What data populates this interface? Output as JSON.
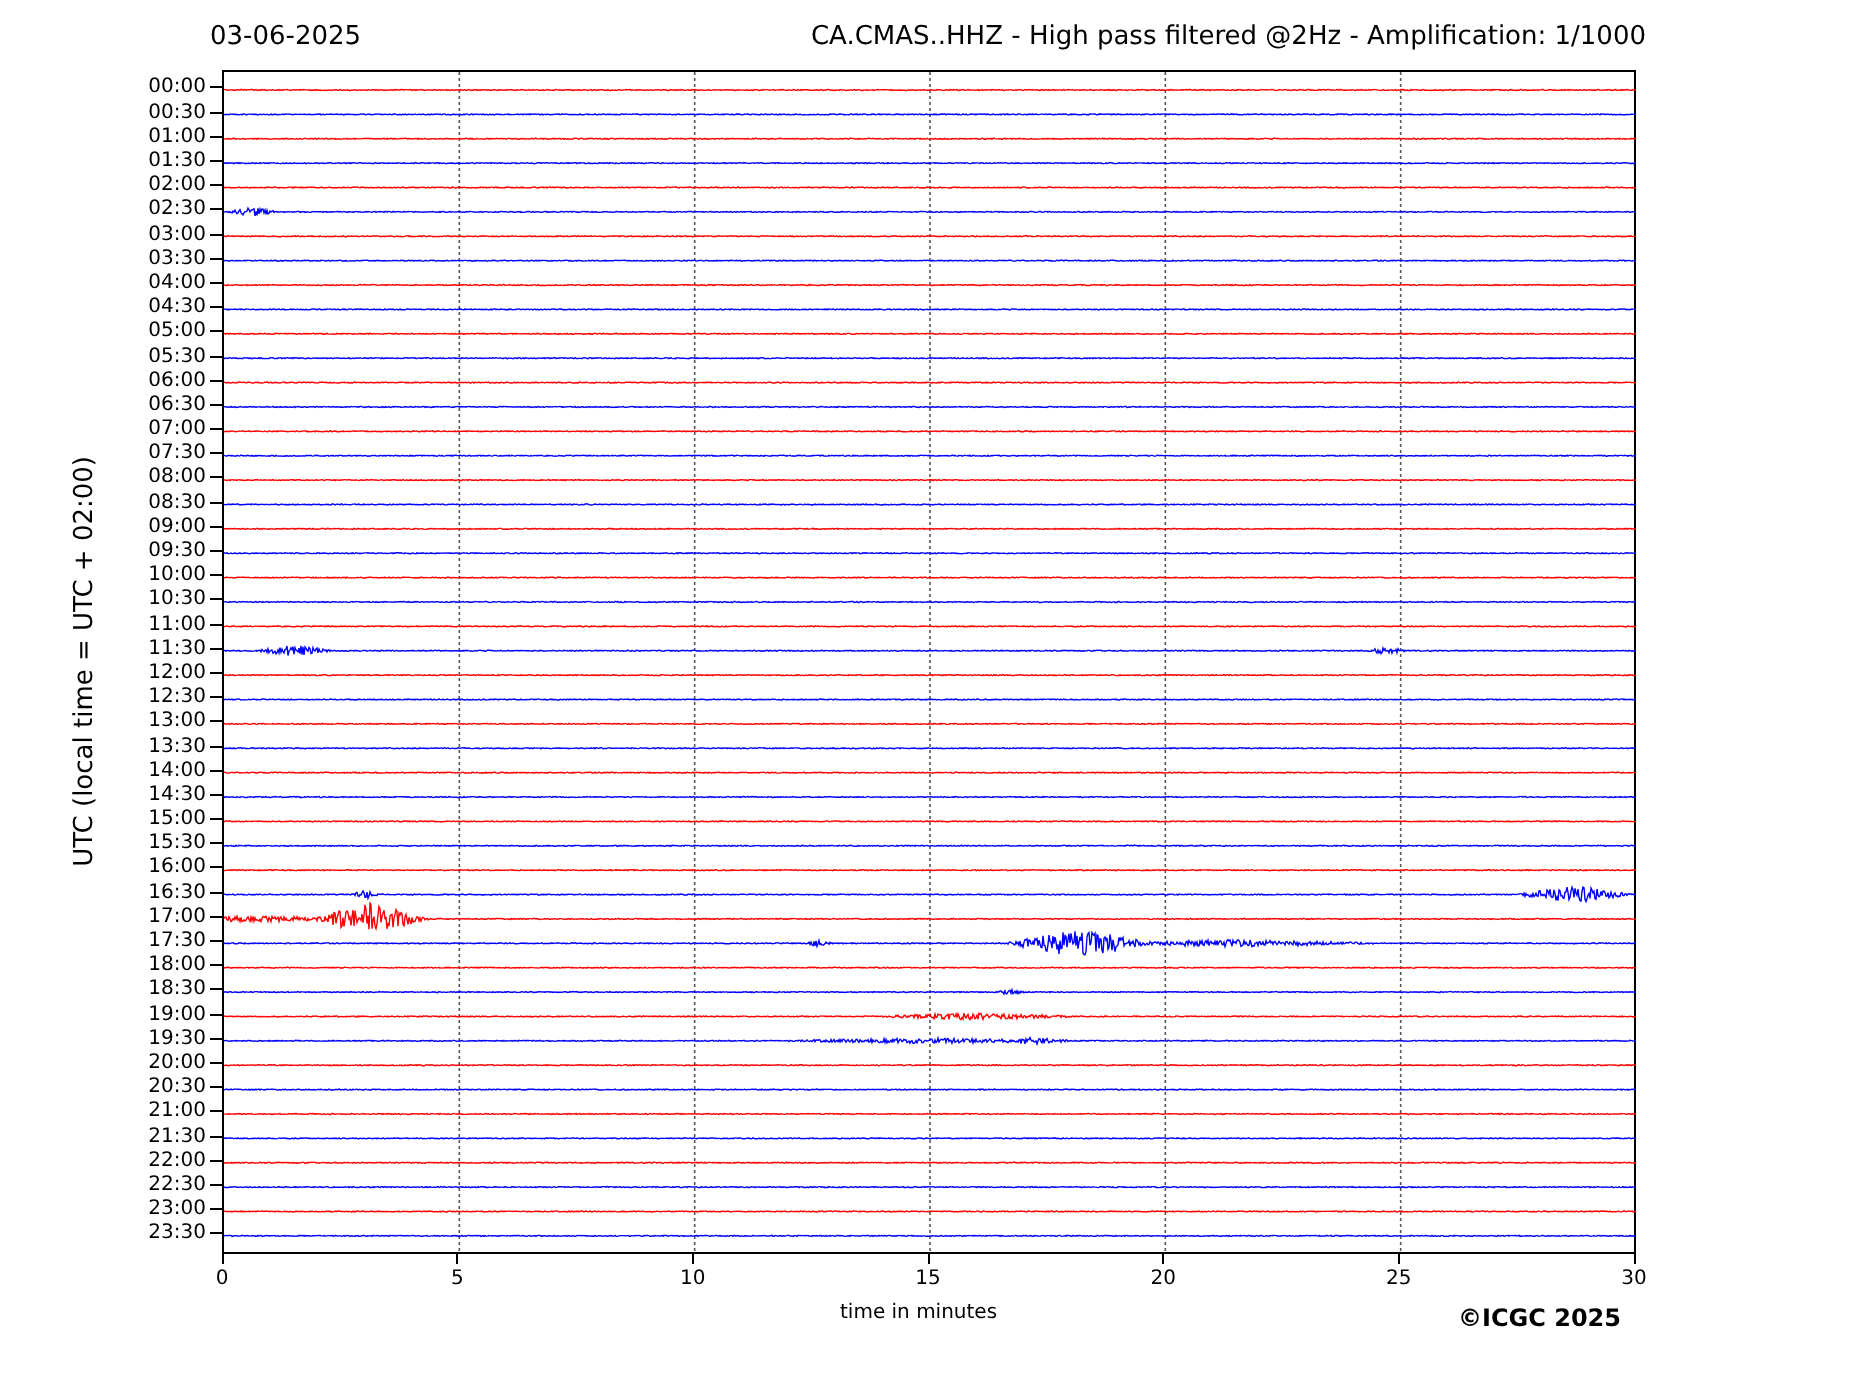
{
  "title_left": "03-06-2025",
  "title_right": "CA.CMAS..HHZ - High pass filtered @2Hz - Amplification: 1/1000",
  "y_axis_label": "UTC (local time = UTC + 02:00)",
  "rows": [
    {
      "label": "00:00",
      "color": "#ff0000"
    },
    {
      "label": "00:30",
      "color": "#0000ff"
    },
    {
      "label": "01:00",
      "color": "#ff0000"
    },
    {
      "label": "01:30",
      "color": "#0000ff"
    },
    {
      "label": "02:00",
      "color": "#ff0000"
    },
    {
      "label": "02:30",
      "color": "#0000ff"
    },
    {
      "label": "03:00",
      "color": "#ff0000"
    },
    {
      "label": "03:30",
      "color": "#0000ff"
    },
    {
      "label": "04:00",
      "color": "#ff0000"
    },
    {
      "label": "04:30",
      "color": "#0000ff"
    },
    {
      "label": "05:00",
      "color": "#ff0000"
    },
    {
      "label": "05:30",
      "color": "#0000ff"
    },
    {
      "label": "06:00",
      "color": "#ff0000"
    },
    {
      "label": "06:30",
      "color": "#0000ff"
    },
    {
      "label": "07:00",
      "color": "#ff0000"
    },
    {
      "label": "07:30",
      "color": "#0000ff"
    },
    {
      "label": "08:00",
      "color": "#ff0000"
    },
    {
      "label": "08:30",
      "color": "#0000ff"
    },
    {
      "label": "09:00",
      "color": "#ff0000"
    },
    {
      "label": "09:30",
      "color": "#0000ff"
    },
    {
      "label": "10:00",
      "color": "#ff0000"
    },
    {
      "label": "10:30",
      "color": "#0000ff"
    },
    {
      "label": "11:00",
      "color": "#ff0000"
    },
    {
      "label": "11:30",
      "color": "#0000ff"
    },
    {
      "label": "12:00",
      "color": "#ff0000"
    },
    {
      "label": "12:30",
      "color": "#0000ff"
    },
    {
      "label": "13:00",
      "color": "#ff0000"
    },
    {
      "label": "13:30",
      "color": "#0000ff"
    },
    {
      "label": "14:00",
      "color": "#ff0000"
    },
    {
      "label": "14:30",
      "color": "#0000ff"
    },
    {
      "label": "15:00",
      "color": "#ff0000"
    },
    {
      "label": "15:30",
      "color": "#0000ff"
    },
    {
      "label": "16:00",
      "color": "#ff0000"
    },
    {
      "label": "16:30",
      "color": "#0000ff"
    },
    {
      "label": "17:00",
      "color": "#ff0000"
    },
    {
      "label": "17:30",
      "color": "#0000ff"
    },
    {
      "label": "18:00",
      "color": "#ff0000"
    },
    {
      "label": "18:30",
      "color": "#0000ff"
    },
    {
      "label": "19:00",
      "color": "#ff0000"
    },
    {
      "label": "19:30",
      "color": "#0000ff"
    },
    {
      "label": "20:00",
      "color": "#ff0000"
    },
    {
      "label": "20:30",
      "color": "#0000ff"
    },
    {
      "label": "21:00",
      "color": "#ff0000"
    },
    {
      "label": "21:30",
      "color": "#0000ff"
    },
    {
      "label": "22:00",
      "color": "#ff0000"
    },
    {
      "label": "22:30",
      "color": "#0000ff"
    },
    {
      "label": "23:00",
      "color": "#ff0000"
    },
    {
      "label": "23:30",
      "color": "#0000ff"
    }
  ],
  "x_ticks": [
    "0",
    "5",
    "10",
    "15",
    "20",
    "25",
    "30"
  ],
  "x_axis_label": "time in minutes",
  "copyright": "©ICGC 2025"
}
